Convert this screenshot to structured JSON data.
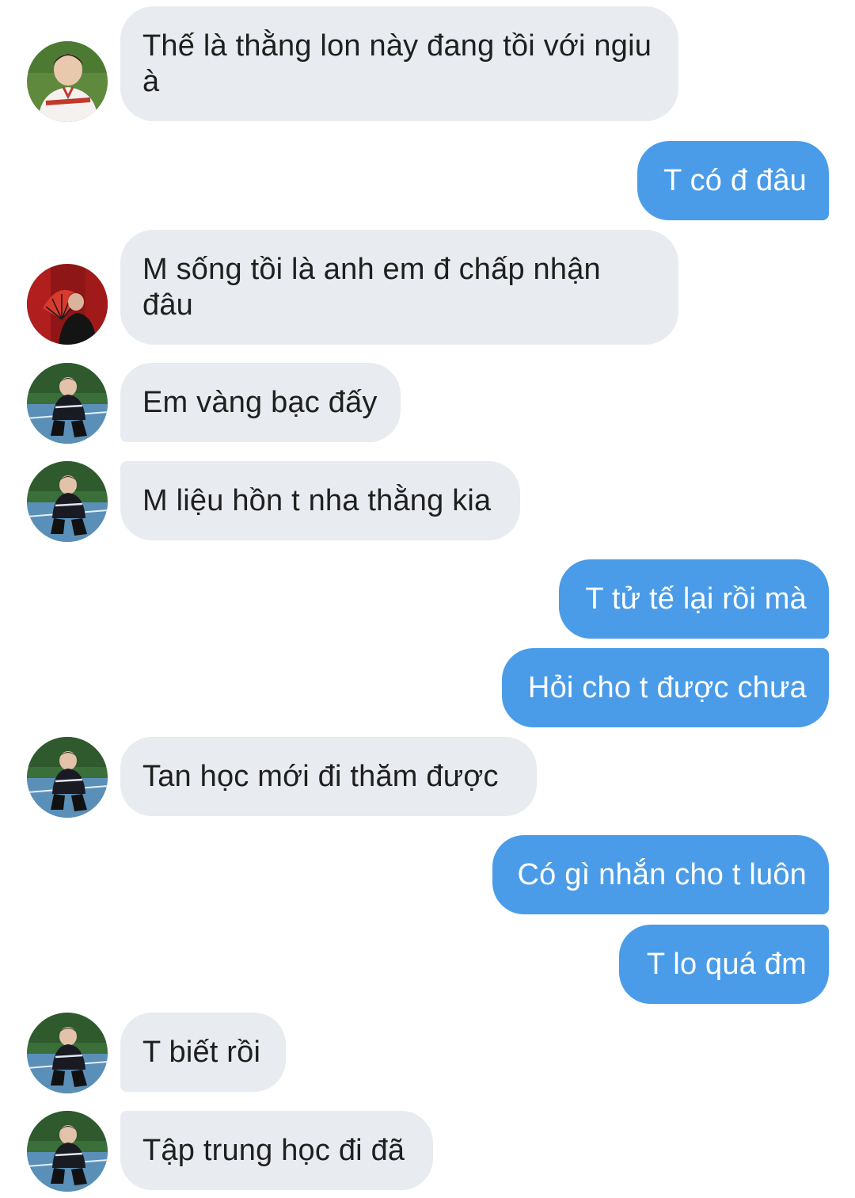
{
  "messages": [
    {
      "id": "m1",
      "direction": "incoming",
      "avatar": "avatar-baseball-jersey",
      "text": "Thế là thằng lon này đang tồi với ngiu à"
    },
    {
      "id": "m2",
      "direction": "outgoing",
      "text": "T có đ đâu"
    },
    {
      "id": "m3",
      "direction": "incoming",
      "avatar": "avatar-red-fan",
      "text": "M sống tồi là anh em đ chấp nhận đâu"
    },
    {
      "id": "m4",
      "direction": "incoming",
      "avatar": "avatar-court-crouch",
      "text": "Em vàng bạc đấy"
    },
    {
      "id": "m5",
      "direction": "incoming",
      "avatar": "avatar-court-crouch",
      "text": "M liệu hồn t nha thằng kia"
    },
    {
      "id": "m6",
      "direction": "outgoing",
      "text": "T tử tế lại rồi mà"
    },
    {
      "id": "m7",
      "direction": "outgoing",
      "text": "Hỏi cho t được chưa"
    },
    {
      "id": "m8",
      "direction": "incoming",
      "avatar": "avatar-court-crouch",
      "text": "Tan học mới đi thăm được"
    },
    {
      "id": "m9",
      "direction": "outgoing",
      "text": "Có gì nhắn cho t luôn"
    },
    {
      "id": "m10",
      "direction": "outgoing",
      "text": "T lo quá đm"
    },
    {
      "id": "m11",
      "direction": "incoming",
      "avatar": "avatar-court-crouch",
      "text": "T biết rồi"
    },
    {
      "id": "m12",
      "direction": "incoming",
      "avatar": "avatar-court-crouch",
      "text": "Tập trung học đi đã"
    }
  ],
  "colors": {
    "incoming_bubble": "#e8ebef",
    "outgoing_bubble": "#4a9ce8",
    "incoming_text": "#1f1f1f",
    "outgoing_text": "#ffffff",
    "background": "#ffffff"
  }
}
